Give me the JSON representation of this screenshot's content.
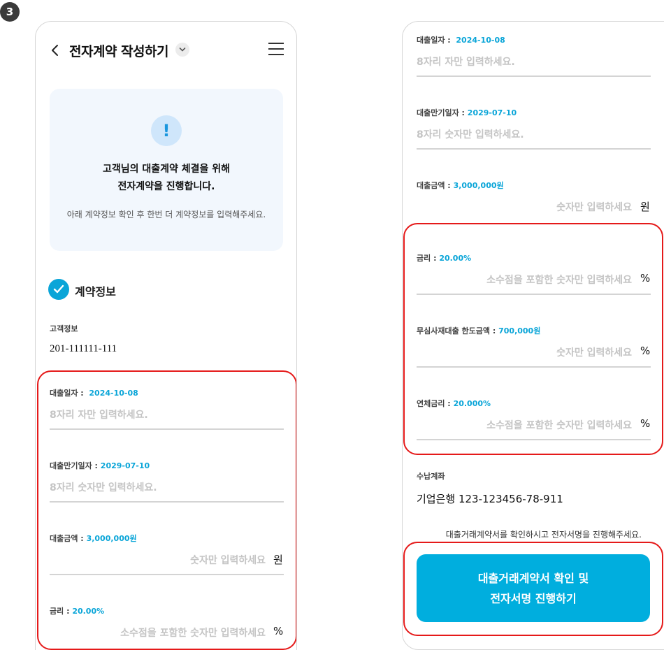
{
  "step": "3",
  "header": {
    "title": "전자계약 작성하기"
  },
  "notice": {
    "line1": "고객님의 대출계약 체결을 위해",
    "line2": "전자계약을 진행합니다.",
    "sub": "아래 계약정보 확인 후 한번 더 계약정보를 입력해주세요."
  },
  "section": {
    "title": "계약정보"
  },
  "customer": {
    "label": "고객정보",
    "value": "201-111111-111"
  },
  "fields": {
    "loan_date": {
      "label": "대출일자 :",
      "value": "2024-10-08",
      "placeholder": "8자리 자만 입력하세요."
    },
    "maturity_date": {
      "label": "대출만기일자 :",
      "value": "2029-07-10",
      "placeholder": "8자리 숫자만 입력하세요."
    },
    "loan_amount": {
      "label": "대출금액 :",
      "value": "3,000,000원",
      "placeholder": "숫자만 입력하세요",
      "unit": "원"
    },
    "interest_rate": {
      "label": "금리 :",
      "value": "20.00%",
      "placeholder": "소수점을 포함한 숫자만 입력하세요",
      "unit": "%"
    },
    "limit_amount": {
      "label": "무심사재대출 한도금액 :",
      "value": "700,000원",
      "placeholder": "숫자만 입력하세요",
      "unit": "%"
    },
    "overdue_rate": {
      "label": "연체금리 :",
      "value": "20.000%",
      "placeholder": "소수점을 포함한 숫자만 입력하세요",
      "unit": "%"
    }
  },
  "account": {
    "label": "수납계좌",
    "value": "기업은행 123-123456-78-911"
  },
  "consent": "대출거래계약서를 확인하시고 전자서명을 진행해주세요.",
  "cta": {
    "line1": "대출거래계약서 확인 및",
    "line2": "전자서명 진행하기"
  },
  "colors": {
    "accent": "#0aa5d8",
    "cta": "#00aede",
    "highlight": "#e51a1a"
  },
  "icons": [
    "back-icon",
    "chevron-down-icon",
    "menu-icon",
    "exclamation-icon",
    "check-icon"
  ]
}
